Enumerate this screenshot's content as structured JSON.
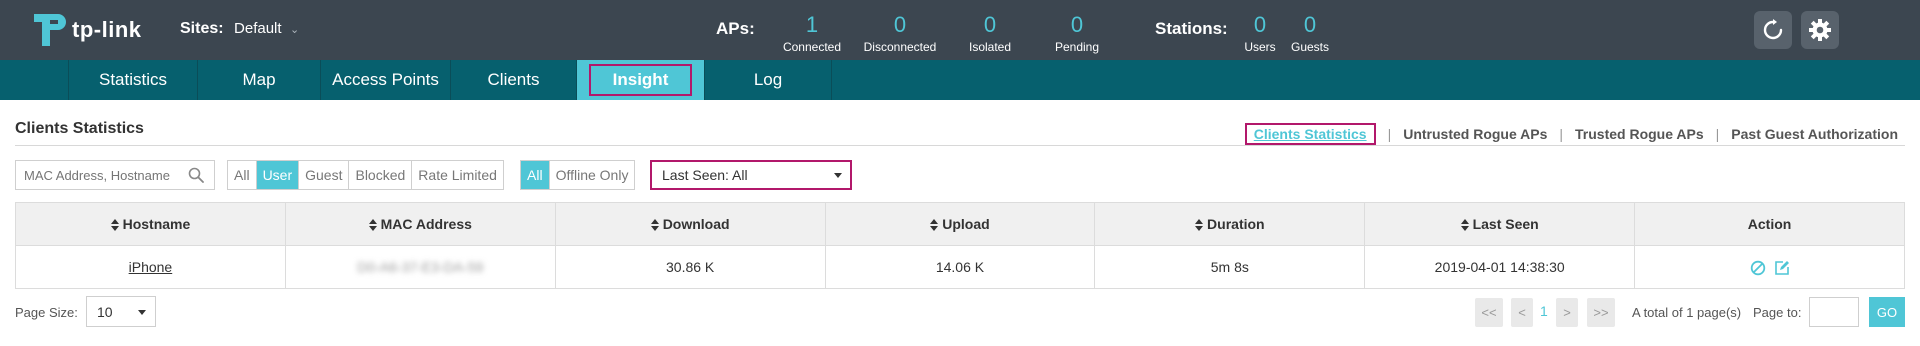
{
  "brand": {
    "name": "tp-link"
  },
  "header": {
    "sites_label": "Sites:",
    "site_value": "Default",
    "aps_label": "APs:",
    "aps": [
      {
        "value": "1",
        "caption": "Connected"
      },
      {
        "value": "0",
        "caption": "Disconnected"
      },
      {
        "value": "0",
        "caption": "Isolated"
      },
      {
        "value": "0",
        "caption": "Pending"
      }
    ],
    "stations_label": "Stations:",
    "stations": [
      {
        "value": "0",
        "caption": "Users"
      },
      {
        "value": "0",
        "caption": "Guests"
      }
    ],
    "refresh_icon": "refresh-icon",
    "settings_icon": "gear-icon"
  },
  "nav": {
    "items": [
      {
        "label": "Statistics"
      },
      {
        "label": "Map"
      },
      {
        "label": "Access Points"
      },
      {
        "label": "Clients"
      },
      {
        "label": "Insight",
        "active": true
      },
      {
        "label": "Log"
      }
    ]
  },
  "page": {
    "title": "Clients Statistics",
    "subnav": [
      {
        "label": "Clients Statistics",
        "active": true
      },
      {
        "label": "Untrusted Rogue APs"
      },
      {
        "label": "Trusted Rogue APs"
      },
      {
        "label": "Past Guest Authorization"
      }
    ]
  },
  "filters": {
    "search_placeholder": "MAC Address, Hostname",
    "type_options": [
      "All",
      "User",
      "Guest",
      "Blocked",
      "Rate Limited"
    ],
    "type_selected": "User",
    "status_options": [
      "All",
      "Offline Only"
    ],
    "status_selected": "All",
    "last_seen": "Last Seen: All"
  },
  "table": {
    "columns": [
      "Hostname",
      "MAC Address",
      "Download",
      "Upload",
      "Duration",
      "Last Seen",
      "Action"
    ],
    "rows": [
      {
        "hostname": "iPhone",
        "mac": "D0-A6-37-E3-DA-59",
        "download": "30.86 K",
        "upload": "14.06 K",
        "duration": "5m 8s",
        "last_seen": "2019-04-01 14:38:30"
      }
    ]
  },
  "footer": {
    "page_size_label": "Page Size:",
    "page_size": "10",
    "first": "<<",
    "prev": "<",
    "current_page": "1",
    "next": ">",
    "last": ">>",
    "total": "A total of 1 page(s)",
    "page_to_label": "Page to:",
    "go": "GO"
  },
  "colors": {
    "accent": "#4fc6d6",
    "header_bg": "#3c4650",
    "nav_bg": "#06606e",
    "highlight": "#b2186b"
  }
}
